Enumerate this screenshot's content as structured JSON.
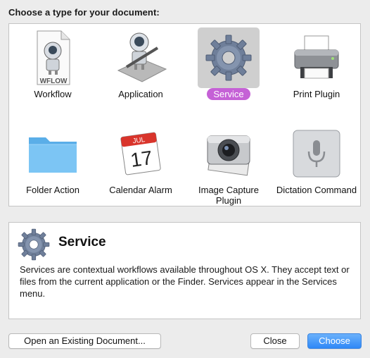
{
  "heading": "Choose a type for your document:",
  "types": [
    {
      "label": "Workflow",
      "icon": "workflow-document-icon",
      "badge": "WFLOW"
    },
    {
      "label": "Application",
      "icon": "automator-robot-icon"
    },
    {
      "label": "Service",
      "icon": "gear-icon",
      "selected": true
    },
    {
      "label": "Print Plugin",
      "icon": "printer-icon"
    },
    {
      "label": "Folder Action",
      "icon": "folder-icon"
    },
    {
      "label": "Calendar Alarm",
      "icon": "calendar-icon",
      "month": "JUL",
      "day": "17"
    },
    {
      "label": "Image Capture Plugin",
      "icon": "camera-icon"
    },
    {
      "label": "Dictation Command",
      "icon": "microphone-icon"
    }
  ],
  "description": {
    "title": "Service",
    "icon": "gear-icon",
    "text": "Services are contextual workflows available throughout OS X. They accept text or files from the current application or the Finder. Services appear in the Services menu."
  },
  "buttons": {
    "open_existing": "Open an Existing Document...",
    "close": "Close",
    "choose": "Choose"
  },
  "colors": {
    "selection_pill": "#c561d6",
    "primary_button": "#2e88f7",
    "window_bg": "#ececec"
  }
}
